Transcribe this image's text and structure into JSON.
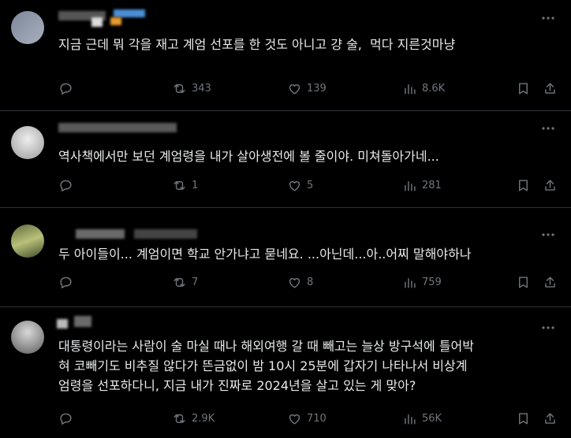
{
  "posts": [
    {
      "text": "지금 근데 뭐 각을 재고 계엄 선포를 한 것도 아니고 걍 술,  먹다 지른것마냥",
      "replies": "",
      "reposts": "343",
      "likes": "139",
      "views": "8.6K"
    },
    {
      "text": "역사책에서만 보던 계엄령을 내가 살아생전에 볼 줄이야. 미쳐돌아가네...",
      "replies": "",
      "reposts": "1",
      "likes": "5",
      "views": "281"
    },
    {
      "text": "두 아이들이... 계엄이면 학교 안가냐고 묻네요. ...아닌데...아..어찌 말해야하나",
      "replies": "",
      "reposts": "7",
      "likes": "8",
      "views": "759"
    },
    {
      "text": "대통령이라는 사람이 술 마실 때나 해외여행 갈 때 빼고는 늘상 방구석에 틀어박\n혀 코빼기도 비추질 않다가 뜬금없이 밤 10시 25분에 갑자기 나타나서 비상계\n엄령을 선포하다니, 지금 내가 진짜로 2024년을 살고 있는 게 맞아?",
      "replies": "",
      "reposts": "2.9K",
      "likes": "710",
      "views": "56K"
    }
  ],
  "colors": {
    "background": "#000000",
    "text": "#e7e9ea",
    "muted": "#71767b",
    "divider": "#2f3336"
  },
  "icons": [
    "reply-icon",
    "repost-icon",
    "like-icon",
    "views-icon",
    "bookmark-icon",
    "share-icon",
    "more-icon"
  ]
}
